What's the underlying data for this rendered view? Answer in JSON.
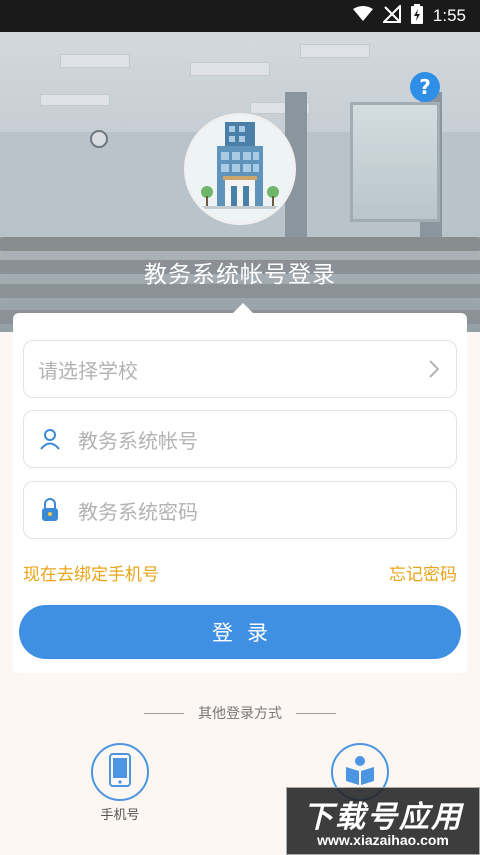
{
  "status_bar": {
    "time": "1:55",
    "wifi_icon": "wifi-icon",
    "signal_icon": "no-signal-icon",
    "battery_icon": "battery-charging-icon"
  },
  "help": {
    "label": "?",
    "icon": "help-icon"
  },
  "header": {
    "title": "教务系统帐号登录"
  },
  "form": {
    "school_placeholder": "请选择学校",
    "account_placeholder": "教务系统帐号",
    "password_placeholder": "教务系统密码",
    "bind_phone_link": "现在去绑定手机号",
    "forgot_password_link": "忘记密码",
    "login_button": "登录"
  },
  "other_login": {
    "label": "其他登录方式",
    "methods": [
      {
        "label": "手机号",
        "icon": "phone-icon"
      },
      {
        "label": "",
        "icon": "book-reader-icon"
      }
    ]
  },
  "watermark": {
    "title": "下载号应用",
    "site": "www.xiazaihao.com"
  },
  "colors": {
    "accent": "#3f8fe2",
    "link": "#e9a418",
    "help": "#2f8fe6"
  }
}
